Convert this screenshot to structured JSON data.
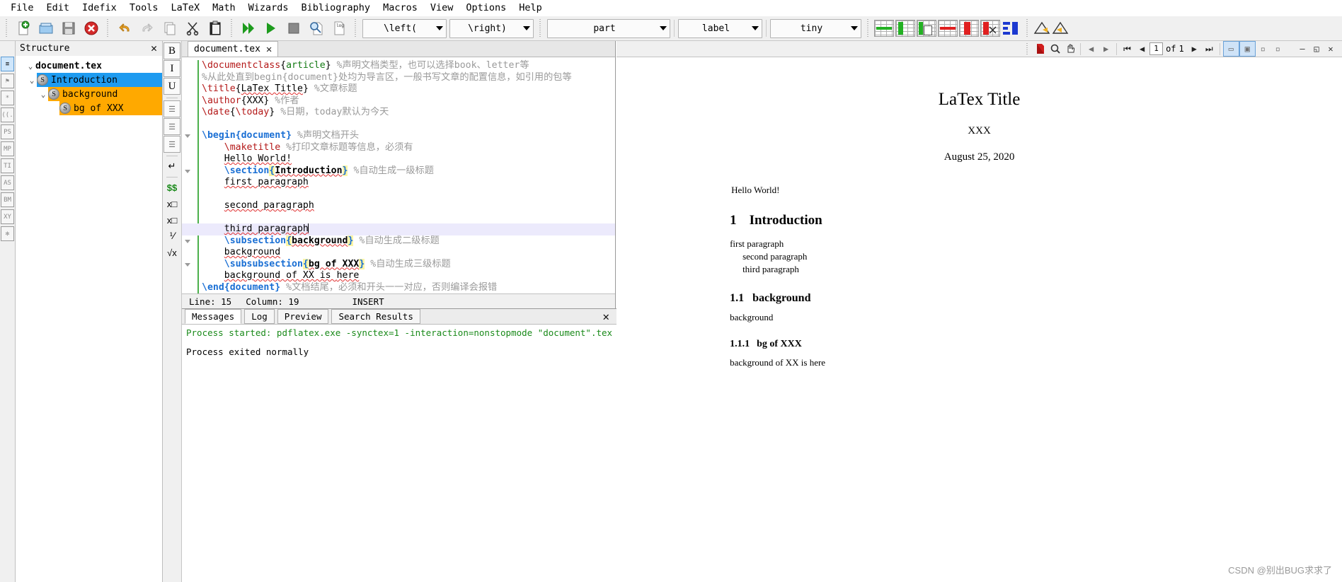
{
  "menubar": {
    "items": [
      "File",
      "Edit",
      "Idefix",
      "Tools",
      "LaTeX",
      "Math",
      "Wizards",
      "Bibliography",
      "Macros",
      "View",
      "Options",
      "Help"
    ]
  },
  "toolbar": {
    "buttons": [
      {
        "name": "new-document",
        "icon": "new-file-icon"
      },
      {
        "name": "open-document",
        "icon": "open-folder-icon"
      },
      {
        "name": "save-document",
        "icon": "save-disk-icon"
      },
      {
        "name": "close-document",
        "icon": "close-red-icon"
      },
      {
        "name": "undo",
        "icon": "undo-arrow-icon"
      },
      {
        "name": "redo",
        "icon": "redo-arrow-icon"
      },
      {
        "name": "copy",
        "icon": "copy-page-icon"
      },
      {
        "name": "cut",
        "icon": "scissors-icon"
      },
      {
        "name": "paste",
        "icon": "clipboard-icon"
      },
      {
        "name": "build-and-view",
        "icon": "double-green-arrow-icon"
      },
      {
        "name": "compile",
        "icon": "green-arrow-icon"
      },
      {
        "name": "stop-compile",
        "icon": "stop-square-icon"
      },
      {
        "name": "view-pdf",
        "icon": "magnifier-page-icon"
      },
      {
        "name": "view-log",
        "icon": "log-page-icon"
      }
    ],
    "combos": [
      {
        "name": "left-delimiter-select",
        "value": "\\left("
      },
      {
        "name": "right-delimiter-select",
        "value": "\\right)"
      },
      {
        "name": "section-level-select",
        "value": "part"
      },
      {
        "name": "reference-type-select",
        "value": "label"
      },
      {
        "name": "font-size-select",
        "value": "tiny"
      }
    ],
    "table_tools": [
      {
        "name": "insert-row-above",
        "color": "#23b123"
      },
      {
        "name": "insert-column-left",
        "color": "#23b123"
      },
      {
        "name": "paste-column",
        "color": "#23b123"
      },
      {
        "name": "delete-row",
        "color": "#e02020"
      },
      {
        "name": "delete-column",
        "color": "#e02020"
      },
      {
        "name": "cut-column",
        "color": "#e02020"
      },
      {
        "name": "align-columns",
        "color": "#1c39d0"
      }
    ],
    "warning_tools": [
      {
        "name": "warning-indicator-1"
      },
      {
        "name": "warning-indicator-2"
      }
    ]
  },
  "rail": {
    "items": [
      {
        "name": "structure-view",
        "label": "≡",
        "selected": true
      },
      {
        "name": "bookmarks-view",
        "label": "⚑"
      },
      {
        "name": "symbols-view",
        "label": "*"
      },
      {
        "name": "brackets-view",
        "label": "((."
      },
      {
        "name": "ps-symbols-view",
        "label": "PS"
      },
      {
        "name": "mp-symbols-view",
        "label": "MP"
      },
      {
        "name": "ti-symbols-view",
        "label": "TI"
      },
      {
        "name": "as-symbols-view",
        "label": "AS"
      },
      {
        "name": "bm-symbols-view",
        "label": "BM"
      },
      {
        "name": "xy-symbols-view",
        "label": "XY"
      },
      {
        "name": "favorites-view",
        "label": "✻"
      }
    ]
  },
  "structure": {
    "title": "Structure",
    "close_label": "✕",
    "tree": [
      {
        "name": "tree-root-document",
        "label": "document.tex",
        "depth": 0,
        "chevron": "⌄",
        "icon": null,
        "state": "none",
        "bold": true
      },
      {
        "name": "tree-item-introduction",
        "label": "Introduction",
        "depth": 1,
        "chevron": "⌄",
        "icon": "S",
        "state": "selected-blue",
        "bold": false
      },
      {
        "name": "tree-item-background",
        "label": "background",
        "depth": 2,
        "chevron": "⌄",
        "icon": "S",
        "state": "selected-orange",
        "bold": false
      },
      {
        "name": "tree-item-bg-of-xxx",
        "label": "bg of XXX",
        "depth": 3,
        "chevron": "",
        "icon": "S",
        "state": "selected-orange",
        "bold": false
      }
    ]
  },
  "editor_tools": {
    "items": [
      {
        "name": "bold-button",
        "label": "B",
        "boxed": true
      },
      {
        "name": "italic-button",
        "label": "I",
        "boxed": true
      },
      {
        "name": "underline-button",
        "label": "U",
        "boxed": true
      },
      {
        "name": "align-left-button",
        "label": "☰",
        "boxed": true
      },
      {
        "name": "align-center-button",
        "label": "☰",
        "boxed": true
      },
      {
        "name": "align-right-button",
        "label": "☰",
        "boxed": true
      },
      {
        "name": "newline-button",
        "label": "↵",
        "boxed": false
      },
      {
        "name": "math-mode-button",
        "label": "$$",
        "boxed": false
      },
      {
        "name": "subscript-button",
        "label": "x□",
        "boxed": false
      },
      {
        "name": "superscript-button",
        "label": "x□",
        "boxed": false
      },
      {
        "name": "fraction-button",
        "label": "⅟",
        "boxed": false
      },
      {
        "name": "sqrt-button",
        "label": "√x",
        "boxed": false
      }
    ]
  },
  "editor": {
    "tab": {
      "name": "editor-tab-document-tex",
      "label": "document.tex",
      "close": "✕"
    },
    "lines": [
      {
        "n": 1,
        "fold": false,
        "current": false,
        "tokens": [
          {
            "t": "\\documentclass",
            "c": "cmd"
          },
          {
            "t": "{",
            "c": "plain"
          },
          {
            "t": "article",
            "c": "green"
          },
          {
            "t": "} ",
            "c": "plain"
          },
          {
            "t": "%声明文档类型，也可以选择book、letter等",
            "c": "cmt"
          }
        ]
      },
      {
        "n": 2,
        "fold": false,
        "current": false,
        "tokens": [
          {
            "t": "%从此处直到begin{document}处均为导言区，一般书写文章的配置信息，如引用的包等",
            "c": "cmt"
          }
        ]
      },
      {
        "n": 3,
        "fold": false,
        "current": false,
        "tokens": [
          {
            "t": "\\title",
            "c": "cmd"
          },
          {
            "t": "{",
            "c": "plain"
          },
          {
            "t": "LaTex Title",
            "c": "spell"
          },
          {
            "t": "} ",
            "c": "plain"
          },
          {
            "t": "%文章标题",
            "c": "cmt"
          }
        ]
      },
      {
        "n": 4,
        "fold": false,
        "current": false,
        "tokens": [
          {
            "t": "\\author",
            "c": "cmd"
          },
          {
            "t": "{XXX} ",
            "c": "plain"
          },
          {
            "t": "%作者",
            "c": "cmt"
          }
        ]
      },
      {
        "n": 5,
        "fold": false,
        "current": false,
        "tokens": [
          {
            "t": "\\date",
            "c": "cmd"
          },
          {
            "t": "{",
            "c": "plain"
          },
          {
            "t": "\\today",
            "c": "cmd"
          },
          {
            "t": "} ",
            "c": "plain"
          },
          {
            "t": "%日期，today默认为今天",
            "c": "cmt"
          }
        ]
      },
      {
        "n": 6,
        "fold": false,
        "current": false,
        "tokens": []
      },
      {
        "n": 7,
        "fold": true,
        "current": false,
        "tokens": [
          {
            "t": "\\begin",
            "c": "blue"
          },
          {
            "t": "{document}",
            "c": "blue"
          },
          {
            "t": " ",
            "c": "plain"
          },
          {
            "t": "%声明文档开头",
            "c": "cmt"
          }
        ]
      },
      {
        "n": 8,
        "fold": false,
        "current": false,
        "indent": 1,
        "tokens": [
          {
            "t": "\\maketitle",
            "c": "cmd"
          },
          {
            "t": " ",
            "c": "plain"
          },
          {
            "t": "%打印文章标题等信息，必须有",
            "c": "cmt"
          }
        ]
      },
      {
        "n": 9,
        "fold": false,
        "current": false,
        "indent": 1,
        "tokens": [
          {
            "t": "Hello World!",
            "c": "spell"
          }
        ]
      },
      {
        "n": 10,
        "fold": true,
        "current": false,
        "indent": 1,
        "tokens": [
          {
            "t": "\\section",
            "c": "blue"
          },
          {
            "t": "{",
            "c": "hl"
          },
          {
            "t": "Introduction",
            "c": "boldspell"
          },
          {
            "t": "}",
            "c": "hl"
          },
          {
            "t": " ",
            "c": "plain"
          },
          {
            "t": "%自动生成一级标题",
            "c": "cmt"
          }
        ]
      },
      {
        "n": 11,
        "fold": false,
        "current": false,
        "indent": 1,
        "tokens": [
          {
            "t": "first paragraph",
            "c": "spell"
          }
        ]
      },
      {
        "n": 12,
        "fold": false,
        "current": false,
        "tokens": []
      },
      {
        "n": 13,
        "fold": false,
        "current": false,
        "indent": 1,
        "tokens": [
          {
            "t": "second paragraph",
            "c": "spell"
          }
        ]
      },
      {
        "n": 14,
        "fold": false,
        "current": false,
        "tokens": []
      },
      {
        "n": 15,
        "fold": false,
        "current": true,
        "indent": 1,
        "tokens": [
          {
            "t": "third paragraph",
            "c": "spell"
          },
          {
            "t": "|CARET|",
            "c": "caret"
          }
        ]
      },
      {
        "n": 16,
        "fold": true,
        "current": false,
        "indent": 1,
        "tokens": [
          {
            "t": "\\subsection",
            "c": "blue"
          },
          {
            "t": "{",
            "c": "hl"
          },
          {
            "t": "background",
            "c": "boldspell"
          },
          {
            "t": "}",
            "c": "hl"
          },
          {
            "t": " ",
            "c": "plain"
          },
          {
            "t": "%自动生成二级标题",
            "c": "cmt"
          }
        ]
      },
      {
        "n": 17,
        "fold": false,
        "current": false,
        "indent": 1,
        "tokens": [
          {
            "t": "background",
            "c": "spell"
          }
        ]
      },
      {
        "n": 18,
        "fold": true,
        "current": false,
        "indent": 1,
        "tokens": [
          {
            "t": "\\subsubsection",
            "c": "blue"
          },
          {
            "t": "{",
            "c": "hl"
          },
          {
            "t": "bg of XXX",
            "c": "boldspell"
          },
          {
            "t": "}",
            "c": "hl"
          },
          {
            "t": " ",
            "c": "plain"
          },
          {
            "t": "%自动生成三级标题",
            "c": "cmt"
          }
        ]
      },
      {
        "n": 19,
        "fold": false,
        "current": false,
        "indent": 1,
        "tokens": [
          {
            "t": "background of XX is ",
            "c": "spell"
          },
          {
            "t": "here",
            "c": "spell"
          }
        ]
      },
      {
        "n": 20,
        "fold": false,
        "current": false,
        "tokens": [
          {
            "t": "\\end",
            "c": "blue"
          },
          {
            "t": "{document}",
            "c": "blue"
          },
          {
            "t": " ",
            "c": "plain"
          },
          {
            "t": "%文档结尾，必须和开头一一对应，否则编译会报错",
            "c": "cmt"
          }
        ]
      }
    ]
  },
  "statusbar": {
    "line_label": "Line: 15",
    "column_label": "Column: 19",
    "mode_label": "INSERT"
  },
  "messages": {
    "tabs": [
      {
        "name": "tab-messages",
        "label": "Messages",
        "active": true
      },
      {
        "name": "tab-log",
        "label": "Log",
        "active": false
      },
      {
        "name": "tab-preview",
        "label": "Preview",
        "active": false
      },
      {
        "name": "tab-search-results",
        "label": "Search Results",
        "active": false
      }
    ],
    "close_label": "✕",
    "line1": "Process started: pdflatex.exe -synctex=1 -interaction=nonstopmode \"document\".tex",
    "line2": "Process exited normally"
  },
  "pdf": {
    "toolbar": {
      "buttons": [
        {
          "name": "open-pdf-external-icon",
          "glyph": "A"
        },
        {
          "name": "zoom-search-icon",
          "glyph": "Q"
        },
        {
          "name": "hand-pan-icon",
          "glyph": "H"
        },
        {
          "name": "back-arrow-icon",
          "glyph": "←"
        },
        {
          "name": "forward-arrow-icon",
          "glyph": "→"
        },
        {
          "name": "first-page-icon",
          "glyph": "⏮"
        },
        {
          "name": "previous-page-icon",
          "glyph": "◀"
        }
      ],
      "page_current": "1",
      "page_of_label": "of",
      "page_total": "1",
      "buttons_after": [
        {
          "name": "next-page-icon",
          "glyph": "▶"
        },
        {
          "name": "last-page-icon",
          "glyph": "⏭"
        },
        {
          "name": "fit-width-icon",
          "glyph": "⬌"
        },
        {
          "name": "fit-page-icon",
          "glyph": "▣"
        },
        {
          "name": "single-page-icon",
          "glyph": "□"
        },
        {
          "name": "continuous-page-icon",
          "glyph": "▧"
        }
      ],
      "window_controls": [
        {
          "name": "minimize-dock-button",
          "glyph": "—"
        },
        {
          "name": "restore-dock-button",
          "glyph": "◱"
        },
        {
          "name": "close-dock-button",
          "glyph": "✕"
        }
      ]
    },
    "document": {
      "title": "LaTex Title",
      "author": "XXX",
      "date": "August 25, 2020",
      "intro_line": "Hello World!",
      "section_number": "1",
      "section_title": "Introduction",
      "paragraph_1": "first paragraph",
      "paragraph_2": "second paragraph",
      "paragraph_3": "third paragraph",
      "subsection_number": "1.1",
      "subsection_title": "background",
      "subsection_body": "background",
      "subsubsection_number": "1.1.1",
      "subsubsection_title": "bg of XXX",
      "subsubsection_body": "background of XX is here"
    },
    "watermark": "CSDN @别出BUG求求了"
  },
  "colors": {
    "select_blue": "#1e9bf0",
    "select_orange": "#ffa900",
    "keyword_blue": "#1a6fd4",
    "command_red": "#b41818",
    "comment_gray": "#9a9a9a",
    "success_green": "#1a8a1a"
  }
}
